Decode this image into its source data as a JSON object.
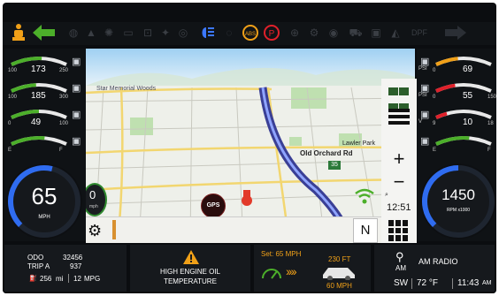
{
  "top_telltales": {
    "status_icons": [
      "seatbelt-icon",
      "turn-left-arrow-icon",
      "trailer-icon",
      "high-beam-icon",
      "abs-icon",
      "parking-brake-icon",
      "turn-right-arrow-icon"
    ],
    "colors": {
      "active_green": "#4caf2a",
      "amber": "#f0a018",
      "red": "#e0202a",
      "blue": "#3c78ff"
    }
  },
  "left_gauges": [
    {
      "icon": "temperature-icon",
      "value": "173",
      "min": "100",
      "max": "250",
      "fill": 0.55,
      "color": "#4caf2a"
    },
    {
      "icon": "trans-temp-icon",
      "value": "185",
      "min": "100",
      "max": "300",
      "fill": 0.45,
      "color": "#4caf2a"
    },
    {
      "icon": "oil-pressure-icon",
      "value": "49",
      "min": "0",
      "max": "100",
      "fill": 0.5,
      "color": "#4caf2a"
    },
    {
      "icon": "fuel-icon",
      "value": "",
      "min": "E",
      "max": "F",
      "fill": 0.6,
      "color": "#4caf2a"
    }
  ],
  "right_gauges": [
    {
      "icon": "turbo-boost-icon",
      "value": "69",
      "unit": "PSI",
      "min": "0",
      "max": "",
      "fill": 0.4,
      "color": "#f0a018"
    },
    {
      "icon": "air-pressure-icon",
      "value": "55",
      "unit": "PSI",
      "min": "0",
      "max": "150",
      "fill": 0.35,
      "color": "#e0202a"
    },
    {
      "icon": "battery-icon",
      "value": "10",
      "unit": "V",
      "min": "9",
      "max": "18",
      "fill": 0.2,
      "color": "#e0202a"
    },
    {
      "icon": "def-icon",
      "value": "",
      "min": "E",
      "max": "F",
      "fill": 0.6,
      "color": "#4caf2a"
    }
  ],
  "speedometer": {
    "value": "65",
    "unit": "MPH",
    "fill": 0.55
  },
  "tachometer": {
    "value": "1450",
    "unit": "RPM x1000",
    "fill": 0.5
  },
  "map": {
    "labels": [
      "Star Memorial Woods",
      "Lawler Park",
      "Old Orchard Rd"
    ],
    "route_shield": "35",
    "speed_chip": {
      "value": "0",
      "unit": "mph"
    },
    "gps_badge": "GPS",
    "compass": "N",
    "clock": "12:51",
    "zoom_in": "+",
    "zoom_out": "−",
    "search_icon": "search-icon"
  },
  "odometer": {
    "odo_label": "ODO",
    "odo_value": "32456",
    "trip_label": "TRIP A",
    "trip_value": "937",
    "range_value": "256",
    "range_unit": "mi",
    "economy_value": "12",
    "economy_unit": "MPG"
  },
  "warning": {
    "line1": "HIGH ENGINE OIL",
    "line2": "TEMPERATURE"
  },
  "cruise": {
    "set_label": "Set: 65 MPH",
    "distance": "230 FT",
    "lead_speed": "60 MPH"
  },
  "media": {
    "source": "AM RADIO",
    "source_badge": "AM",
    "band": "SW",
    "temperature": "72 °F",
    "time": "11:43",
    "ampm": "AM"
  }
}
